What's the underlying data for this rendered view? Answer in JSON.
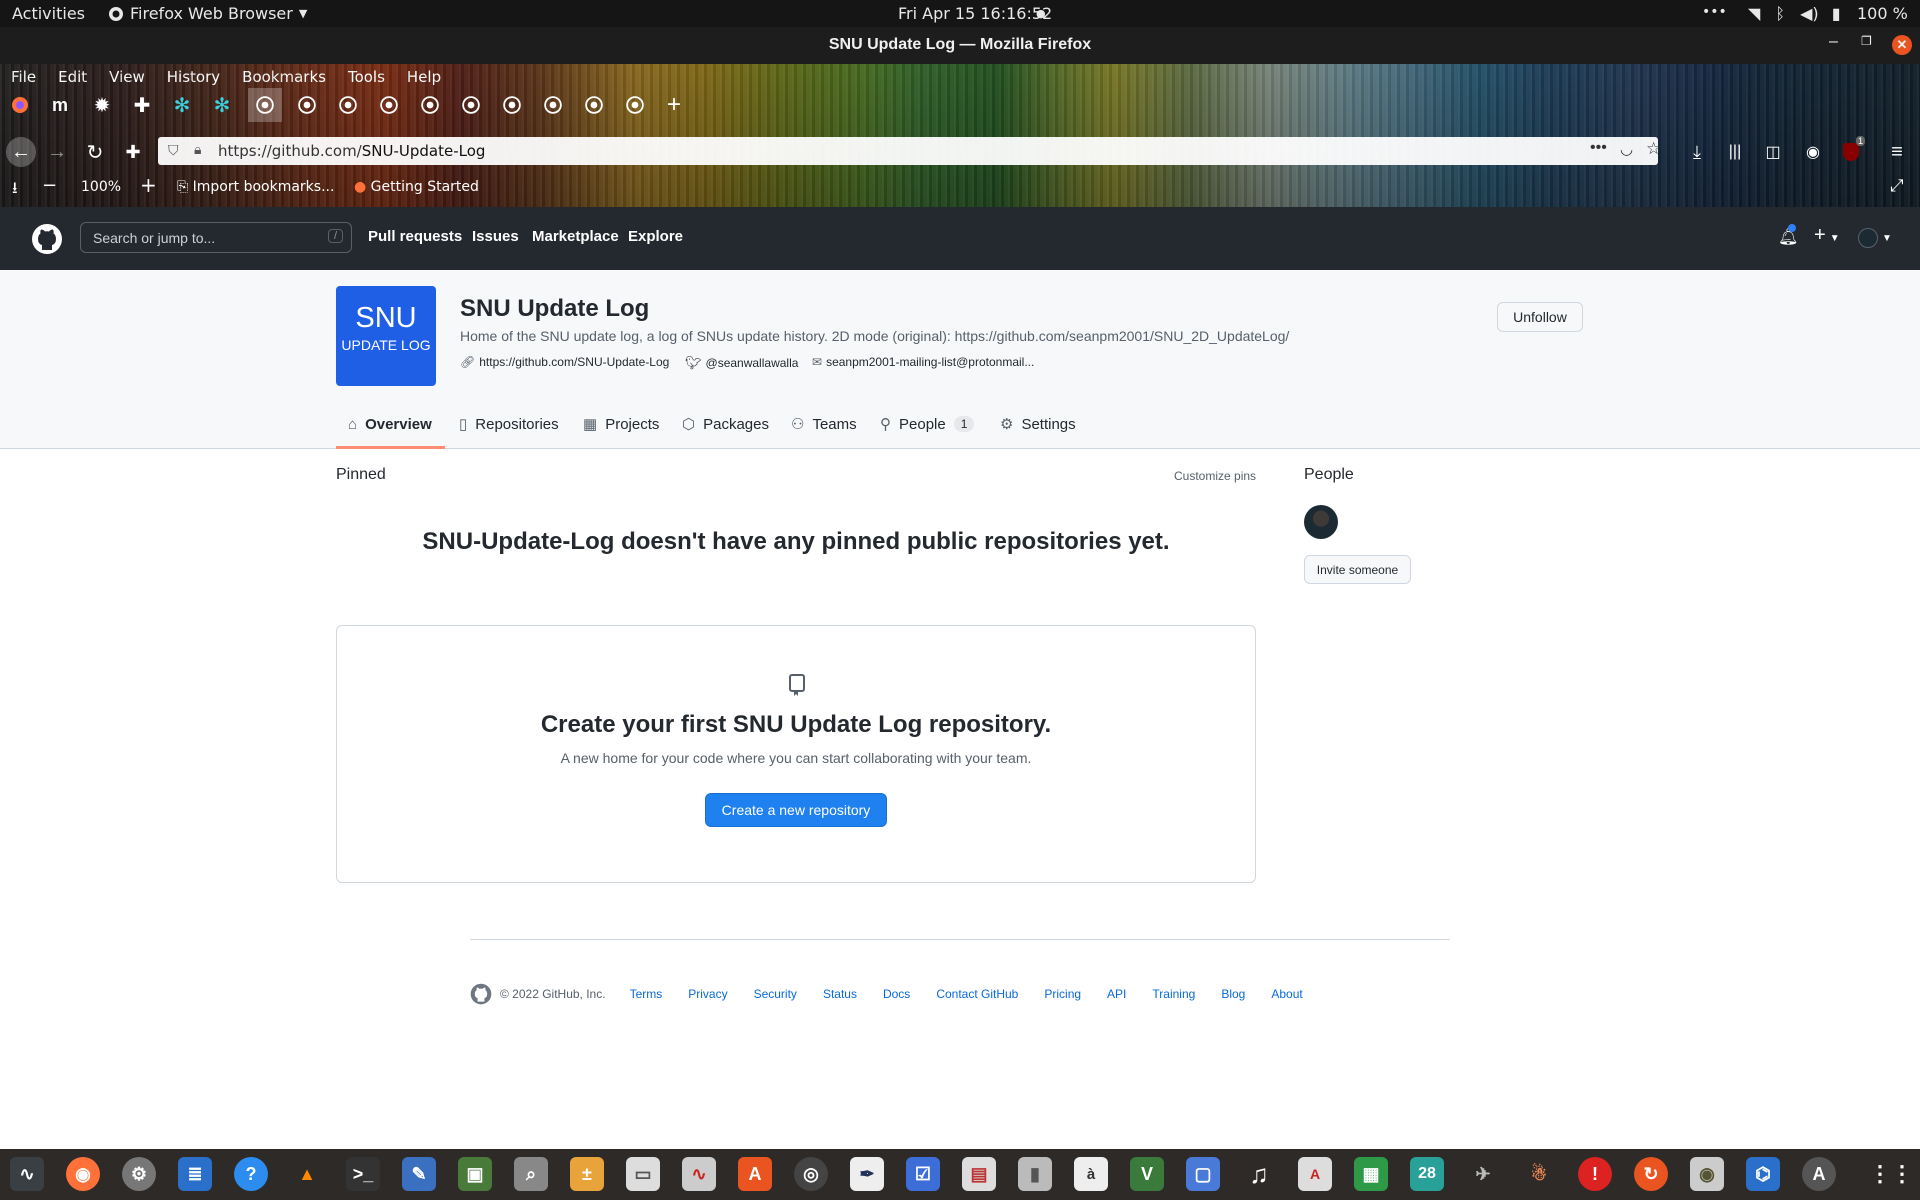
{
  "topbar": {
    "activities": "Activities",
    "app": "Firefox Web Browser",
    "datetime": "Fri Apr 15  16:16:52",
    "battery": "100 %"
  },
  "window": {
    "title": "SNU Update Log — Mozilla Firefox"
  },
  "firefox": {
    "menus": [
      "File",
      "Edit",
      "View",
      "History",
      "Bookmarks",
      "Tools",
      "Help"
    ],
    "url_prefix": "https://github.com/",
    "url_path": "SNU-Update-Log",
    "zoom": "100%",
    "bookmarks": [
      "Import bookmarks...",
      "Getting Started"
    ],
    "ublock_badge": "1"
  },
  "github": {
    "search_placeholder": "Search or jump to...",
    "search_key": "/",
    "nav": [
      "Pull requests",
      "Issues",
      "Marketplace",
      "Explore"
    ]
  },
  "org": {
    "logo_line1": "SNU",
    "logo_line2": "UPDATE LOG",
    "name": "SNU Update Log",
    "description": "Home of the SNU update log, a log of SNUs update history. 2D mode (original): https://github.com/seanpm2001/SNU_2D_UpdateLog/",
    "website": "https://github.com/SNU-Update-Log",
    "twitter": "@seanwallawalla",
    "email": "seanpm2001-mailing-list@protonmail...",
    "unfollow": "Unfollow",
    "tabs": {
      "overview": "Overview",
      "repositories": "Repositories",
      "projects": "Projects",
      "packages": "Packages",
      "teams": "Teams",
      "people": "People",
      "people_count": "1",
      "settings": "Settings"
    }
  },
  "main": {
    "pinned": "Pinned",
    "customize": "Customize pins",
    "no_pins": "SNU-Update-Log doesn't have any pinned public repositories yet.",
    "blank_title": "Create your first SNU Update Log repository.",
    "blank_sub": "A new home for your code where you can start collaborating with your team.",
    "create_button": "Create a new repository",
    "people": "People",
    "invite": "Invite someone"
  },
  "footer": {
    "copyright": "© 2022 GitHub, Inc.",
    "links": [
      "Terms",
      "Privacy",
      "Security",
      "Status",
      "Docs",
      "Contact GitHub",
      "Pricing",
      "API",
      "Training",
      "Blog",
      "About"
    ]
  },
  "dock": {
    "calendar_day": "28"
  },
  "colors": {
    "accent": "#1f80f0",
    "gh_header": "#24292f",
    "tab_underline": "#fd8c73"
  }
}
